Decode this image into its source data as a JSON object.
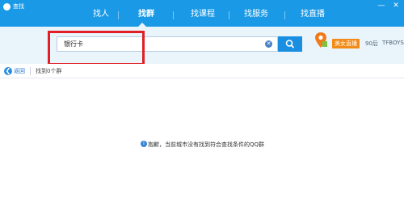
{
  "window": {
    "title": "查找",
    "minimize_glyph": "—",
    "close_glyph": "✕"
  },
  "tabs": [
    {
      "label": "找人"
    },
    {
      "label": "找群"
    },
    {
      "label": "找课程"
    },
    {
      "label": "找服务"
    },
    {
      "label": "找直播"
    }
  ],
  "active_tab": "找群",
  "search": {
    "value": "银行卡",
    "placeholder": "",
    "clear_glyph": "✕"
  },
  "promo": {
    "badge": "美女直播",
    "links": [
      "90后",
      "TFBOYS"
    ]
  },
  "nav": {
    "back_label": "返回",
    "back_glyph": "❮",
    "result_count": "找到0个群"
  },
  "empty_state": {
    "info_glyph": "i",
    "message": "抱歉，当前城市没有找到符合查找条件的QQ群"
  },
  "colors": {
    "header": "#1a9ae6",
    "search_band": "#eaf4fb",
    "search_button": "#1a8ee0",
    "highlight": "#e01f26",
    "badge": "#f28b17"
  },
  "icons": [
    "app-logo-icon",
    "search-icon",
    "clear-icon",
    "location-pin-icon",
    "back-arrow-icon",
    "info-icon"
  ]
}
